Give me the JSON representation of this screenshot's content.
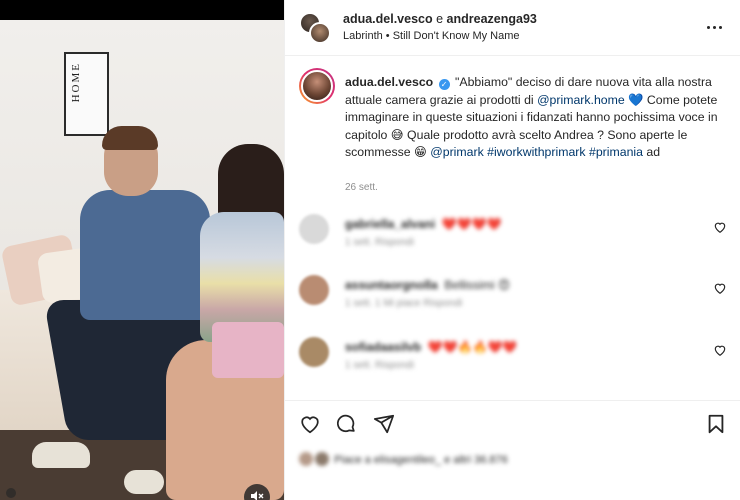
{
  "media": {
    "wall_art_text": "HOME"
  },
  "header": {
    "user1": "adua.del.vesco",
    "joiner": "e",
    "user2": "andreazenga93",
    "music": "Labrinth • Still Don't Know My Name"
  },
  "caption": {
    "username": "adua.del.vesco",
    "part1": "\"Abbiamo\" deciso di dare nuova vita alla nostra attuale camera grazie ai prodotti di ",
    "mention1": "@primark.home",
    "part2": " 💙 Come potete immaginare in queste situazioni i fidanzati hanno pochissima voce in capitolo 😅 Quale prodotto avrà scelto Andrea ? Sono aperte le scommesse 😁 ",
    "mention2": "@primark",
    "hashtag1": "#iworkwithprimark",
    "hashtag2": "#primania",
    "suffix": " ad",
    "date": "26 sett."
  },
  "comments": [
    {
      "name": "gabriella_alvani",
      "text": "❤️❤️❤️❤️",
      "meta": "1 sett. Rispondi",
      "avatar_color": "#d9d9d9"
    },
    {
      "name": "assuntaorgnolla",
      "text": "Bellissimi 😍",
      "meta": "1 sett. 1 Mi piace Rispondi",
      "avatar_color": "#b98c72"
    },
    {
      "name": "sofiadaasilvb",
      "text": "❤️❤️🔥🔥❤️❤️",
      "meta": "1 sett. Rispondi",
      "avatar_color": "#a98a66"
    }
  ],
  "likes": {
    "text": "Piace a elisagentileo_ e altri 36.876"
  },
  "icons": {
    "heart": "heart-icon",
    "comment": "comment-icon",
    "share": "share-icon",
    "save": "bookmark-icon",
    "more": "more-icon",
    "sound": "sound-off-icon"
  }
}
